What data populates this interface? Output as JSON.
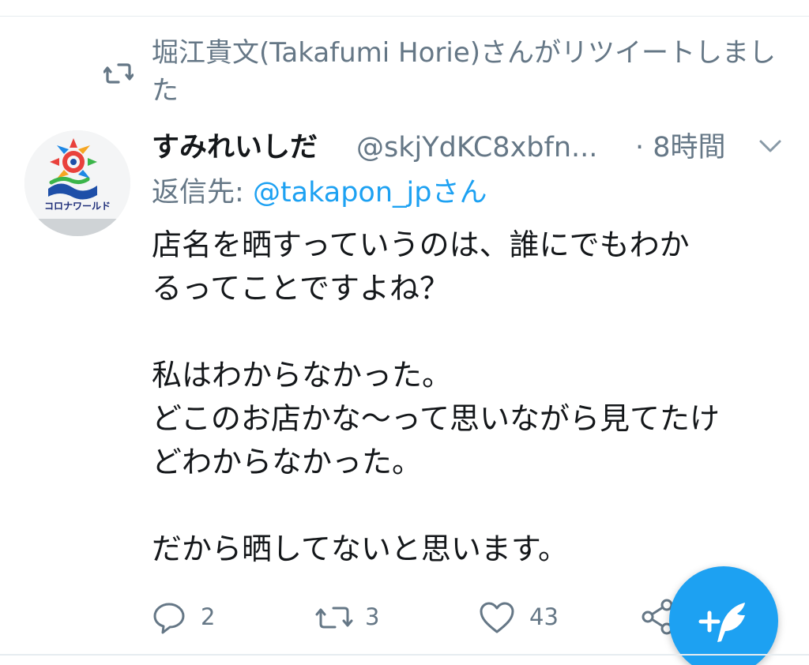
{
  "retweet": {
    "text": "堀江貴文(Takafumi Horie)さんがリツイートしました"
  },
  "tweet": {
    "display_name": "すみれいしだ",
    "handle": "@skjYdKC8xbfn...",
    "dot": "·",
    "time": "8時間",
    "reply_label": "返信先:",
    "reply_mention": "@takapon_jpさん",
    "lines": [
      "店名を晒すっていうのは、誰にでもわか",
      "るってことですよね？",
      "",
      "私はわからなかった。",
      "どこのお店かな～って思いながら見てたけ",
      "どわからなかった。",
      "",
      "だから晒してないと思います。"
    ],
    "avatar_text": "コロナワールド"
  },
  "actions": {
    "reply_count": "2",
    "retweet_count": "3",
    "like_count": "43"
  },
  "colors": {
    "accent": "#1da1f2",
    "secondary_text": "#657786",
    "primary_text": "#14171a"
  },
  "icons": {
    "retweet_indicator": "retweet-icon",
    "menu": "chevron-down-icon",
    "reply": "reply-icon",
    "retweet": "retweet-icon",
    "like": "heart-icon",
    "share": "share-icon",
    "compose": "compose-tweet-icon"
  }
}
